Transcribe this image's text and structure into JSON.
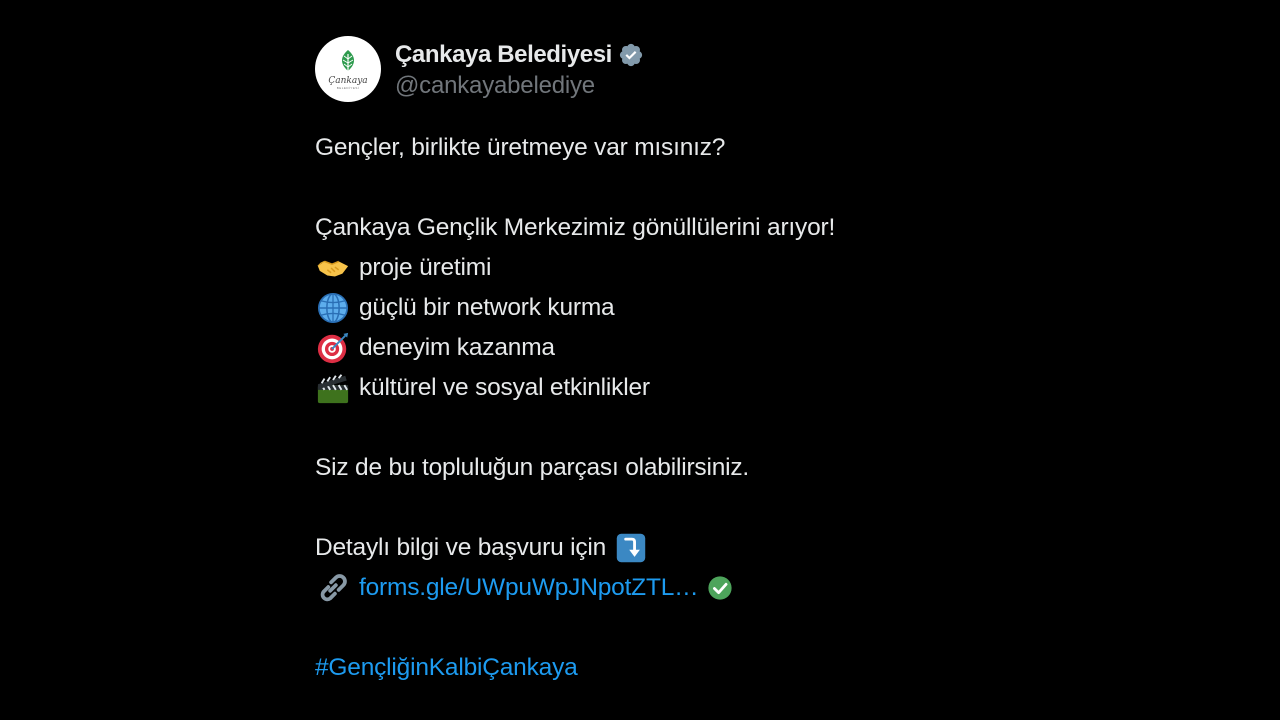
{
  "author": {
    "name": "Çankaya Belediyesi",
    "handle": "@cankayabelediye",
    "avatar_text": "Çankaya",
    "avatar_subtext": "BELEDİYESİ",
    "verified_icon": "verified-badge-icon"
  },
  "tweet": {
    "line1": "Gençler, birlikte üretmeye var mısınız?",
    "line2": "Çankaya Gençlik Merkezimiz gönüllülerini arıyor!",
    "items": [
      {
        "icon": "handshake-icon",
        "text": "proje üretimi"
      },
      {
        "icon": "globe-icon",
        "text": "güçlü bir network kurma"
      },
      {
        "icon": "target-icon",
        "text": "deneyim kazanma"
      },
      {
        "icon": "clapperboard-icon",
        "text": "kültürel ve sosyal etkinlikler"
      }
    ],
    "line3": "Siz de bu topluluğun parçası olabilirsiniz.",
    "line4": "Detaylı bilgi ve başvuru için",
    "line4_icon": "arrow-down-icon",
    "link_icon": "link-icon",
    "link_text": "forms.gle/UWpuWpJNpotZTL…",
    "link_check_icon": "check-icon",
    "hashtag": "#GençliğinKalbiÇankaya"
  },
  "colors": {
    "background": "#000000",
    "text": "#e7e9ea",
    "muted": "#71767b",
    "link": "#1d9bf0",
    "brand_green": "#2e9b4e"
  }
}
